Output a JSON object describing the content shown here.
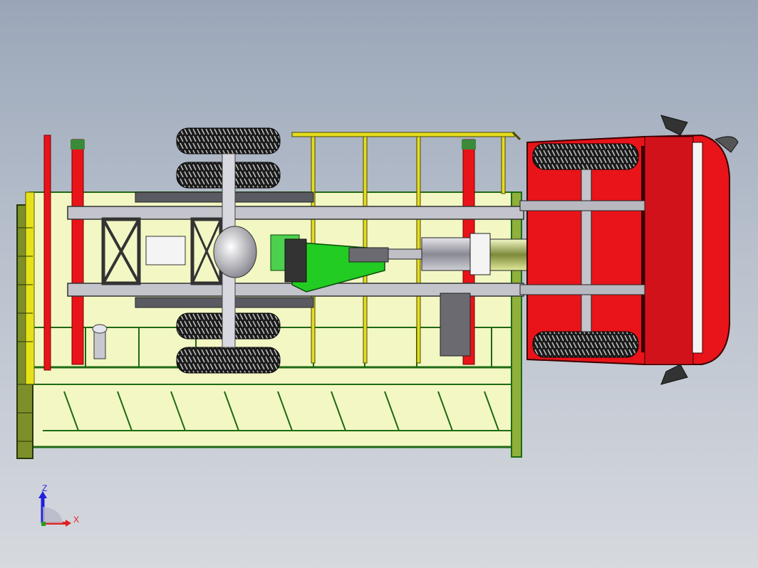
{
  "view": {
    "subject": "truck-chassis-bottom-view",
    "colors": {
      "background_top": "#9aa6b8",
      "background_bottom": "#d6d9de",
      "body_panel": "#f3f7c4",
      "body_frame": "#1e6a12",
      "chassis_frame": "#b8b8c0",
      "cab_red": "#e8141a",
      "tank_green": "#22cc22",
      "tire": "#1a1a1a",
      "rail_yellow": "#e6dc20"
    }
  },
  "triad": {
    "z_label": "Z",
    "x_label": "X",
    "z_color": "#2020e0",
    "x_color": "#e02020",
    "y_color": "#20a020"
  }
}
